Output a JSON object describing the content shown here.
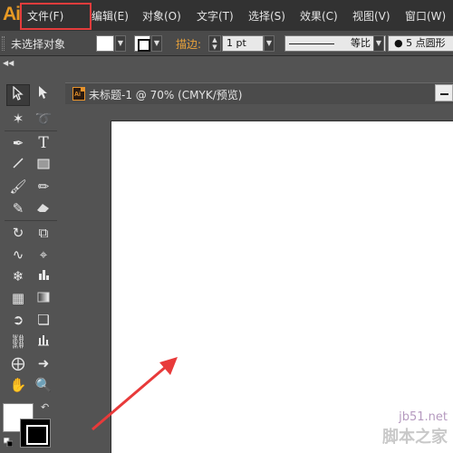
{
  "app": {
    "logo": "Ai"
  },
  "menubar": {
    "items": [
      "文件(F)",
      "编辑(E)",
      "对象(O)",
      "文字(T)",
      "选择(S)",
      "效果(C)",
      "视图(V)",
      "窗口(W)"
    ],
    "highlighted_item": "文件(F)"
  },
  "controlbar": {
    "selection_status": "未选择对象",
    "stroke_label": "描边:",
    "stroke_weight": "1 pt",
    "stroke_profile": "等比",
    "brush_points": "5 点圆形"
  },
  "document": {
    "title": "未标题-1 @ 70% (CMYK/预览)"
  },
  "toolbox": {
    "tools": [
      "selection-tool",
      "direct-selection-tool",
      "magic-wand-tool",
      "lasso-tool",
      "pen-tool",
      "type-tool",
      "line-segment-tool",
      "rectangle-tool",
      "paintbrush-tool",
      "pencil-tool",
      "blob-brush-tool",
      "eraser-tool",
      "rotate-tool",
      "scale-tool",
      "warp-tool",
      "free-transform-tool",
      "symbol-sprayer-tool",
      "column-graph-tool",
      "mesh-tool",
      "gradient-tool",
      "eyedropper-tool",
      "blend-tool",
      "live-paint-bucket-tool",
      "live-paint-selection-tool",
      "artboard-tool",
      "slice-tool",
      "hand-tool",
      "zoom-tool"
    ],
    "fill_color": "#ffffff",
    "stroke_color": "#000000"
  },
  "watermark": {
    "url": "jb51.net",
    "site_name": "脚本之家"
  },
  "colors": {
    "highlight_box": "#e43c3c",
    "annotation_arrow": "#e83a3a",
    "accent": "#e8932b"
  }
}
